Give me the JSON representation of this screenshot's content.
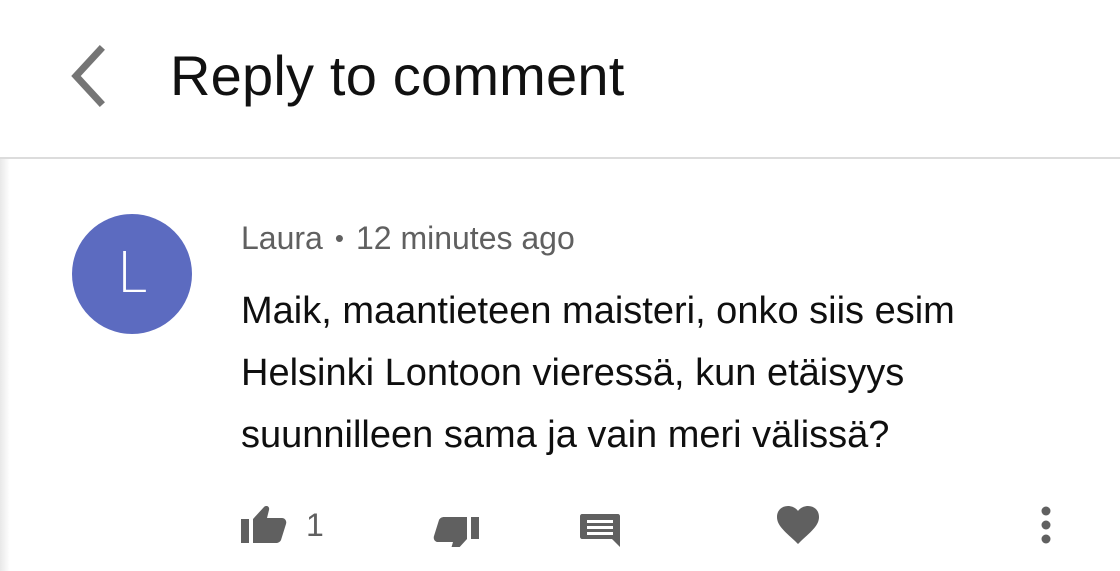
{
  "header": {
    "title": "Reply to comment",
    "back_icon": "chevron-left-icon"
  },
  "comment": {
    "avatar_letter": "L",
    "avatar_color": "#5c6bc0",
    "author": "Laura",
    "separator": "•",
    "time": "12 minutes ago",
    "text": "Maik, maantieteen maisteri, onko siis esim Helsinki Lontoon vieressä, kun etäisyys suunnilleen sama ja vain meri välissä?"
  },
  "actions": {
    "like_icon": "thumbs-up-icon",
    "like_count": "1",
    "dislike_icon": "thumbs-down-icon",
    "reply_icon": "comment-icon",
    "heart_icon": "heart-icon",
    "more_icon": "more-vertical-icon"
  },
  "colors": {
    "icon_gray": "#606060",
    "text_primary": "#0f0f0f",
    "divider": "#dcdcdc"
  }
}
